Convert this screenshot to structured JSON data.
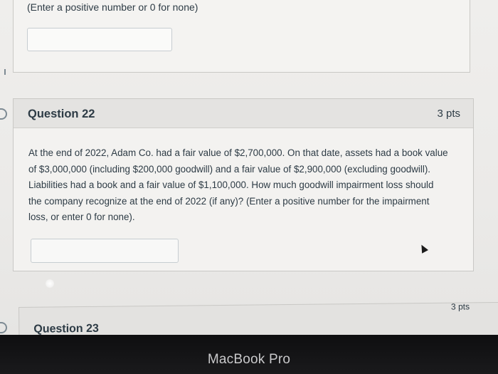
{
  "previous_question": {
    "hint": "(Enter a positive number or 0 for none)",
    "answer_value": ""
  },
  "question": {
    "title": "Question 22",
    "points": "3 pts",
    "lines": [
      "At the end of 2022, Adam Co. had a fair value of $2,700,000. On that date, assets had a book value",
      "of $3,000,000 (including $200,000 goodwill) and a fair value of $2,900,000 (excluding goodwill).",
      "Liabilities had a book and a fair value of $1,100,000. How much goodwill impairment loss should",
      "the company recognize at the end of 2022 (if any)? (Enter a positive number for the impairment",
      "loss, or enter 0 for none)."
    ],
    "answer_value": ""
  },
  "next_question": {
    "title": "Question 23",
    "points": "3 pts"
  },
  "device": {
    "brand": "MacBook Pro"
  }
}
